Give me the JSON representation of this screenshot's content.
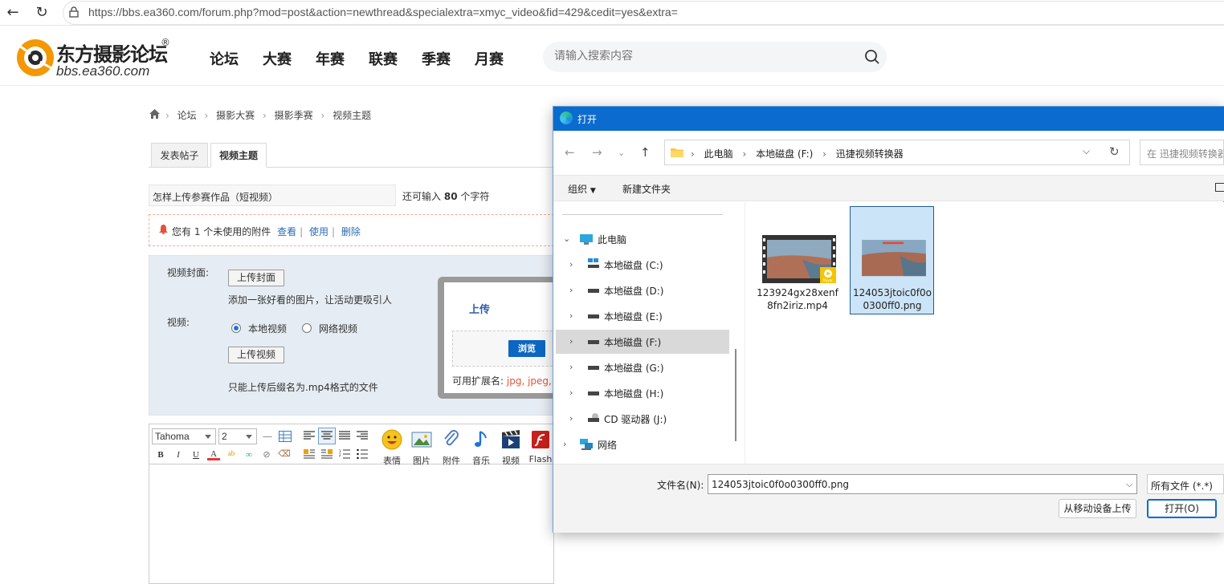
{
  "browser": {
    "url": "https://bbs.ea360.com/forum.php?mod=post&action=newthread&specialextra=xmyc_video&fid=429&cedit=yes&extra="
  },
  "site": {
    "logo_cn": "东方摄影论坛",
    "logo_en": "bbs.ea360.com",
    "logo_reg": "®",
    "nav": [
      "论坛",
      "大赛",
      "年赛",
      "联赛",
      "季赛",
      "月赛"
    ],
    "search_placeholder": "请输入搜索内容"
  },
  "breadcrumb": [
    "论坛",
    "摄影大赛",
    "摄影季赛",
    "视频主题"
  ],
  "tabs": [
    "发表帖子",
    "视频主题"
  ],
  "subject": {
    "value": "怎样上传参赛作品（短视频）",
    "remain_prefix": "还可输入",
    "remain_count": "80",
    "remain_suffix": "个字符"
  },
  "notice": {
    "text": "您有 1 个未使用的附件",
    "view": "查看",
    "use": "使用",
    "delete": "删除",
    "sep": "|"
  },
  "video_form": {
    "cover_label": "视频封面:",
    "cover_button": "上传封面",
    "cover_hint": "添加一张好看的图片，让活动更吸引人",
    "video_label": "视频:",
    "radio_local": "本地视频",
    "radio_net": "网络视频",
    "upload_button": "上传视频",
    "format_hint": "只能上传后缀名为.mp4格式的文件"
  },
  "upload_popup": {
    "title": "上传",
    "browse": "浏览",
    "ext_label": "可用扩展名:",
    "ext_values": "jpg, jpeg, g"
  },
  "editor": {
    "font": "Tahoma",
    "size": "2",
    "tools": [
      "表情",
      "图片",
      "附件",
      "音乐",
      "视频",
      "Flash"
    ]
  },
  "dialog": {
    "title": "打开",
    "path": [
      "此电脑",
      "本地磁盘 (F:)",
      "迅捷视频转换器"
    ],
    "search_placeholder": "在 迅捷视频转换器 中搜索",
    "organize": "组织",
    "new_folder": "新建文件夹",
    "tree": [
      {
        "label": "此电脑",
        "icon": "computer-icon",
        "expanded": true
      },
      {
        "label": "本地磁盘 (C:)",
        "icon": "windows-drive-icon"
      },
      {
        "label": "本地磁盘 (D:)",
        "icon": "drive-icon"
      },
      {
        "label": "本地磁盘 (E:)",
        "icon": "drive-icon"
      },
      {
        "label": "本地磁盘 (F:)",
        "icon": "drive-icon",
        "selected": true
      },
      {
        "label": "本地磁盘 (G:)",
        "icon": "drive-icon"
      },
      {
        "label": "本地磁盘 (H:)",
        "icon": "drive-icon"
      },
      {
        "label": "CD 驱动器 (J:)",
        "icon": "cd-drive-icon"
      },
      {
        "label": "网络",
        "icon": "network-icon"
      }
    ],
    "files": [
      {
        "name": "123924gx28xenf8fn2iriz.mp4",
        "badge": "Player",
        "selected": false
      },
      {
        "name": "124053jtoic0f0o0300ff0.png",
        "selected": true
      }
    ],
    "filename_label": "文件名(N):",
    "filename_value": "124053jtoic0f0o0300ff0.png",
    "filetype": "所有文件 (*.*)",
    "mobile_upload": "从移动设备上传",
    "open": "打开(O)"
  },
  "colors": {
    "dialog_title_bg": "#0b6bce",
    "selected_bg": "#cce4f7",
    "link": "#2b6cb3",
    "accent_orange": "#f39800"
  }
}
